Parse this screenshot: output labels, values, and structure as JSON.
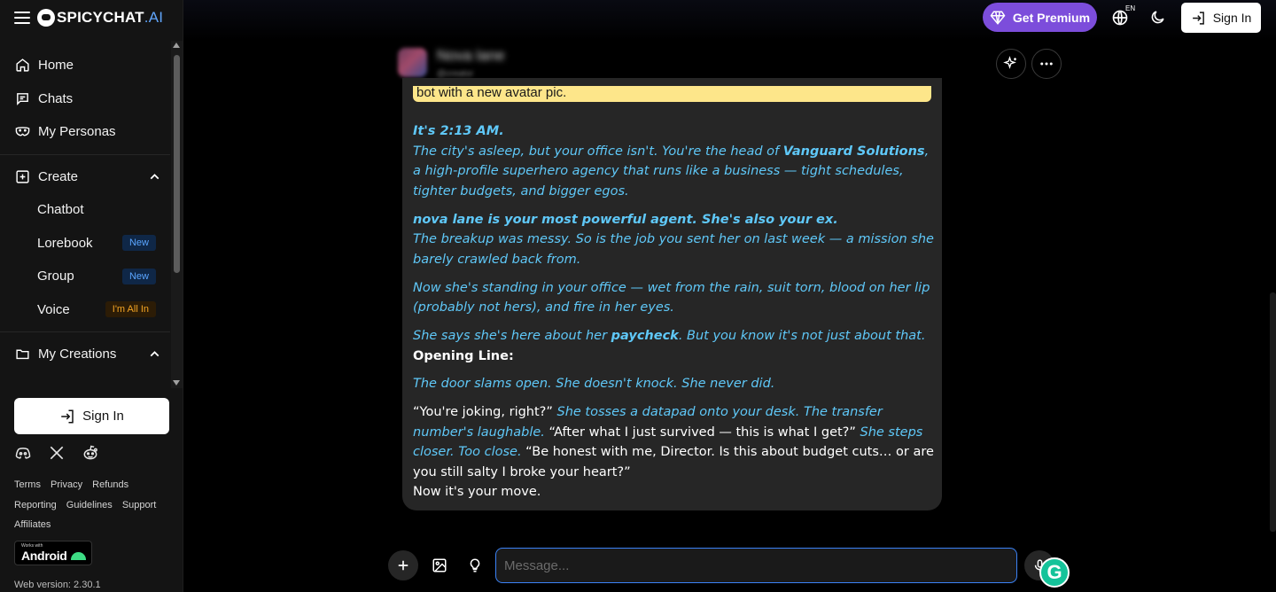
{
  "brand": {
    "name_main": "SPICYCHAT",
    "name_suffix": ".AI"
  },
  "sidebar": {
    "items": [
      {
        "label": "Home",
        "icon": "home-icon"
      },
      {
        "label": "Chats",
        "icon": "chat-icon"
      },
      {
        "label": "My Personas",
        "icon": "mask-icon"
      }
    ],
    "create": {
      "label": "Create",
      "children": [
        {
          "label": "Chatbot"
        },
        {
          "label": "Lorebook",
          "badge": "New"
        },
        {
          "label": "Group",
          "badge": "New"
        },
        {
          "label": "Voice",
          "badge": "I'm All In"
        }
      ]
    },
    "my_creations": "My Creations",
    "sign_in": "Sign In",
    "socials": [
      "discord-icon",
      "x-icon",
      "reddit-icon"
    ],
    "links": [
      "Terms",
      "Privacy",
      "Refunds",
      "Reporting",
      "Guidelines",
      "Support",
      "Affiliates"
    ],
    "android": {
      "small": "Works with",
      "big": "Android"
    },
    "version": "Web version: 2.30.1"
  },
  "topbar": {
    "premium": "Get Premium",
    "language": "EN",
    "sign_in": "Sign In"
  },
  "chat": {
    "bot_name": "Nova lane",
    "bot_handle": "@creator",
    "notice": "bot with a new avatar pic.",
    "message": {
      "time": "It's 2:13 AM.",
      "p1_a": "The city's asleep, but your office isn't. You're the head of ",
      "p1_b": "Vanguard Solutions",
      "p1_c": ", a high-profile superhero agency that runs like a business — tight schedules, tighter budgets, and bigger egos.",
      "p2_head": "nova lane is your most powerful agent. She's also your ex.",
      "p2_body": "The breakup was messy. So is the job you sent her on last week — a mission she barely crawled back from.",
      "p3": "Now she's standing in your office — wet from the rain, suit torn, blood on her lip (probably not hers), and fire in her eyes.",
      "p4_a": "She says she's here about her ",
      "p4_b": "paycheck",
      "p4_c": ". But you know it's not just about that.",
      "opening_label": "Opening Line:",
      "p5": "The door slams open. She doesn't knock. She never did.",
      "q1": "“You're joking, right?” ",
      "a1": "She tosses a datapad onto your desk. The transfer number's laughable.",
      "q2": " “After what I just survived — this is what I get?” ",
      "a2": "She steps closer. Too close.",
      "q3": " “Be honest with me, Director. Is this about budget cuts… or are you still salty I broke your heart?”",
      "end": "Now it's your move."
    },
    "input_placeholder": "Message..."
  }
}
